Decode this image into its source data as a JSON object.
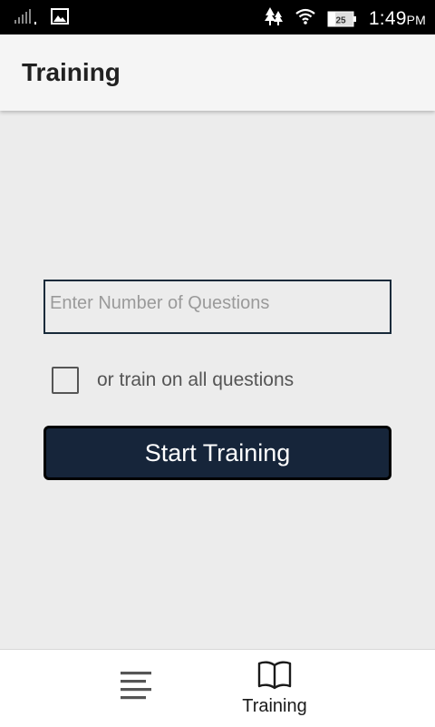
{
  "status_bar": {
    "time": "1:49",
    "time_suffix": "PM",
    "battery": "25",
    "icons": [
      "signal-icon",
      "image-notification-icon",
      "tree-notification-icon",
      "wifi-icon",
      "battery-icon"
    ]
  },
  "app_bar": {
    "title": "Training"
  },
  "form": {
    "question_count_placeholder": "Enter Number of Questions",
    "question_count_value": "",
    "all_questions_label": "or train on all questions",
    "all_questions_checked": false,
    "start_button_label": "Start Training"
  },
  "bottom_nav": {
    "items": [
      {
        "icon": "menu-icon",
        "label": ""
      },
      {
        "icon": "book-icon",
        "label": "Training"
      }
    ]
  },
  "colors": {
    "accent_dark": "#16253a",
    "background": "#ececec"
  }
}
